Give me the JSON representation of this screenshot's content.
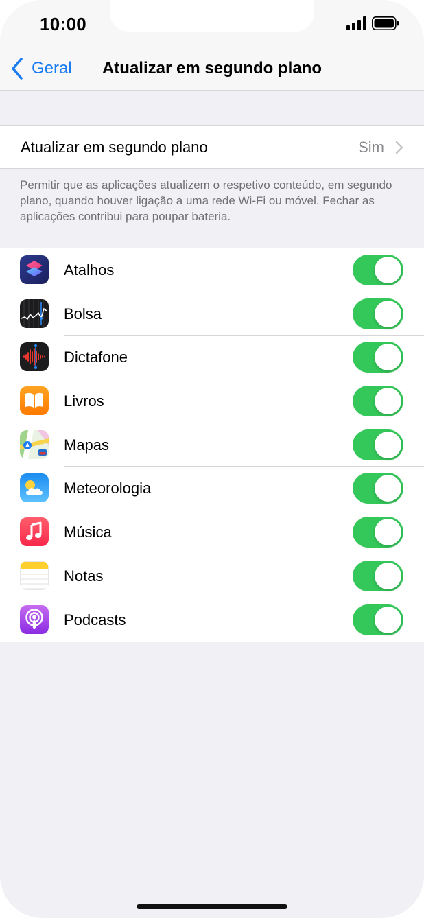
{
  "status_bar": {
    "time": "10:00"
  },
  "nav": {
    "back_label": "Geral",
    "title": "Atualizar em segundo plano"
  },
  "setting": {
    "label": "Atualizar em segundo plano",
    "value": "Sim"
  },
  "footer_note": "Permitir que as aplicações atualizem o respetivo conteúdo, em segundo plano, quando houver ligação a uma rede Wi-Fi ou móvel. Fechar as aplicações contribui para poupar bateria.",
  "apps": [
    {
      "name": "Atalhos",
      "icon": "shortcuts-icon",
      "enabled": true
    },
    {
      "name": "Bolsa",
      "icon": "stocks-icon",
      "enabled": true
    },
    {
      "name": "Dictafone",
      "icon": "voice-memos-icon",
      "enabled": true
    },
    {
      "name": "Livros",
      "icon": "books-icon",
      "enabled": true
    },
    {
      "name": "Mapas",
      "icon": "maps-icon",
      "enabled": true
    },
    {
      "name": "Meteorologia",
      "icon": "weather-icon",
      "enabled": true
    },
    {
      "name": "Música",
      "icon": "music-icon",
      "enabled": true
    },
    {
      "name": "Notas",
      "icon": "notes-icon",
      "enabled": true
    },
    {
      "name": "Podcasts",
      "icon": "podcasts-icon",
      "enabled": true
    }
  ],
  "colors": {
    "accent": "#1a7cf0",
    "toggle_on": "#34c759",
    "background": "#f0f0f5"
  }
}
